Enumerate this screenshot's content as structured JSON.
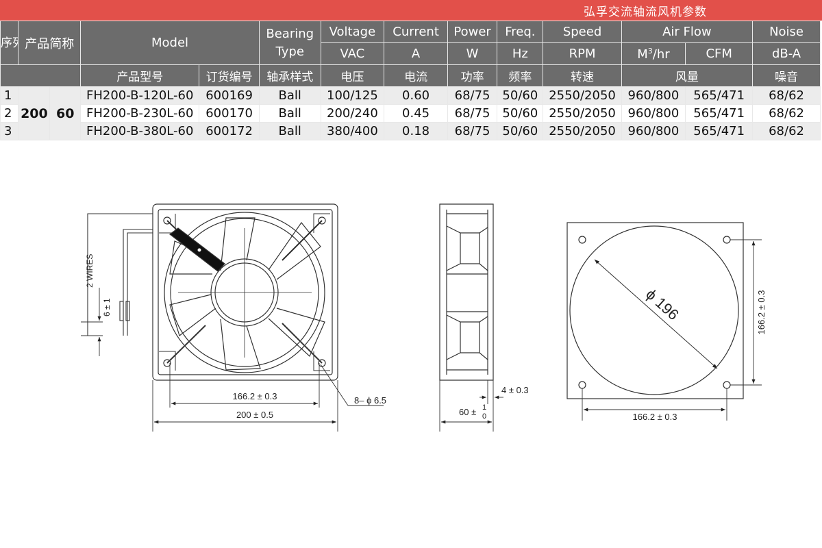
{
  "title": "弘孚交流轴流风机参数",
  "table": {
    "header": {
      "seq": "序列",
      "short_name": "产品简称",
      "model": "Model",
      "bearing_type": "Bearing Type",
      "voltage": "Voltage",
      "current": "Current",
      "power": "Power",
      "freq": "Freq.",
      "speed": "Speed",
      "air_flow": "Air Flow",
      "noise": "Noise",
      "unit_vac": "VAC",
      "unit_a": "A",
      "unit_w": "W",
      "unit_hz": "Hz",
      "unit_rpm": "RPM",
      "unit_m3_base": "M",
      "unit_m3_sup": "3",
      "unit_m3_tail": "/hr",
      "unit_cfm": "CFM",
      "unit_dba": "dB-A",
      "cn_model": "产品型号",
      "cn_order_no": "订货编号",
      "cn_bearing": "轴承样式",
      "cn_voltage": "电压",
      "cn_current": "电流",
      "cn_power": "功率",
      "cn_freq": "频率",
      "cn_speed": "转速",
      "cn_airflow": "风量",
      "cn_noise": "噪音"
    },
    "size_a": "200",
    "size_b": "60",
    "rows": [
      {
        "seq": "1",
        "model": "FH200-B-120L-60",
        "order": "600169",
        "bearing": "Ball",
        "voltage": "100/125",
        "current": "0.60",
        "power": "68/75",
        "freq": "50/60",
        "speed": "2550/2050",
        "m3hr": "960/800",
        "cfm": "565/471",
        "noise": "68/62"
      },
      {
        "seq": "2",
        "model": "FH200-B-230L-60",
        "order": "600170",
        "bearing": "Ball",
        "voltage": "200/240",
        "current": "0.45",
        "power": "68/75",
        "freq": "50/60",
        "speed": "2550/2050",
        "m3hr": "960/800",
        "cfm": "565/471",
        "noise": "68/62"
      },
      {
        "seq": "3",
        "model": "FH200-B-380L-60",
        "order": "600172",
        "bearing": "Ball",
        "voltage": "380/400",
        "current": "0.18",
        "power": "68/75",
        "freq": "50/60",
        "speed": "2550/2050",
        "m3hr": "960/800",
        "cfm": "565/471",
        "noise": "68/62"
      }
    ]
  },
  "drawing": {
    "wires_label": "2 WIRES",
    "wire_dim": "6 ± 1",
    "hole_pitch": "166.2 ± 0.3",
    "outer_size": "200 ± 0.5",
    "hole_spec": "8– ϕ 6.5",
    "depth_main": "60 ±",
    "depth_tol_upper": "1",
    "depth_tol_lower": "0",
    "flange_dim": "4 ± 0.3",
    "cutout_dia": "ϕ 196",
    "cutout_pitch_h": "166.2 ± 0.3",
    "cutout_pitch_v": "166.2 ± 0.3"
  }
}
